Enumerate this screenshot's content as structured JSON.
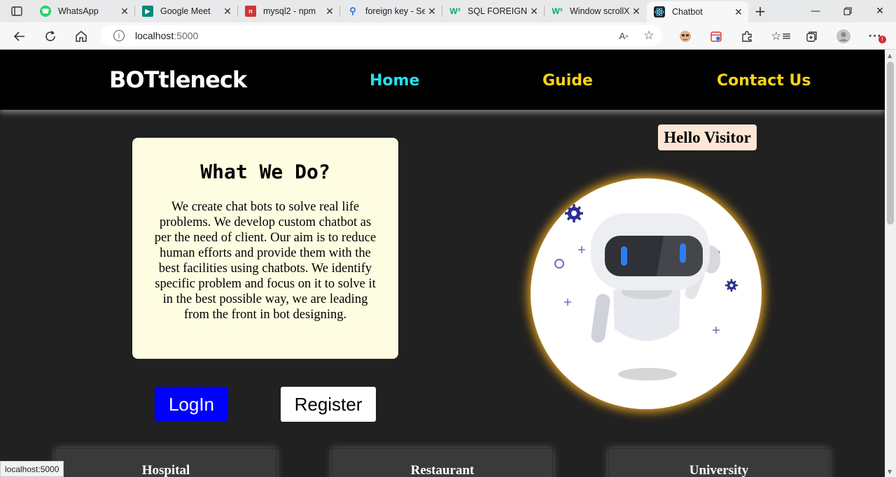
{
  "browser": {
    "tabs": [
      {
        "title": "WhatsApp",
        "icon": "whatsapp-icon",
        "color": "#25d366"
      },
      {
        "title": "Google Meet",
        "icon": "google-meet-icon",
        "color": "#00897b"
      },
      {
        "title": "mysql2 - npm",
        "icon": "npm-icon",
        "color": "#cb3837"
      },
      {
        "title": "foreign key - Se",
        "icon": "search-icon",
        "color": "#1a73e8"
      },
      {
        "title": "SQL FOREIGN K",
        "icon": "w3schools-icon",
        "color": "#04aa6d"
      },
      {
        "title": "Window scrollX",
        "icon": "w3schools-icon",
        "color": "#04aa6d"
      },
      {
        "title": "Chatbot",
        "icon": "react-icon",
        "color": "#61dafb"
      }
    ],
    "url_host": "localhost",
    "url_port": ":5000",
    "status_url": "localhost:5000"
  },
  "site": {
    "brand": "BOTtleneck",
    "nav": {
      "home": "Home",
      "guide": "Guide",
      "contact": "Contact Us"
    },
    "about": {
      "heading": "What We Do?",
      "body": "We create chat bots to solve real life problems. We develop custom chatbot as per the need of client. Our aim is to reduce human efforts and provide them with the best facilities using chatbots. We identify specific problem and focus on it to solve it in the best possible way, we are leading from the front in bot designing."
    },
    "buttons": {
      "login": "LogIn",
      "register": "Register"
    },
    "greeting": "Hello Visitor",
    "services": [
      "Hospital",
      "Restaurant",
      "University"
    ],
    "colors": {
      "home_link": "#25e0ef",
      "nav_link": "#f7d417",
      "login_bg": "#0000ff",
      "card_bg": "#fefde1",
      "glow": "#e0a020"
    }
  }
}
